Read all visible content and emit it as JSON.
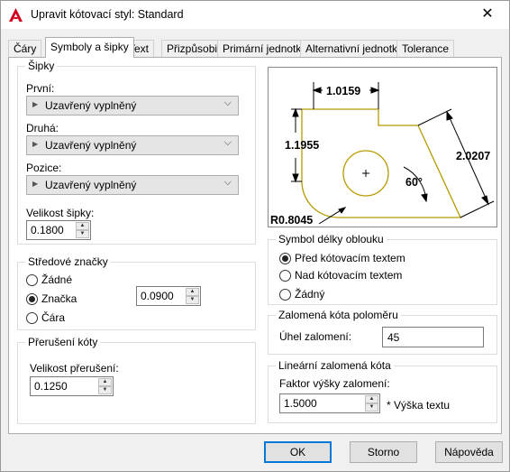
{
  "window": {
    "title": "Upravit kótovací styl: Standard",
    "close_glyph": "✕"
  },
  "tabs": [
    {
      "label": "Čáry"
    },
    {
      "label": "Symboly a šipky"
    },
    {
      "label": "Text"
    },
    {
      "label": "Přizpůsobit"
    },
    {
      "label": "Primární jednotky"
    },
    {
      "label": "Alternativní jednotky"
    },
    {
      "label": "Tolerance"
    }
  ],
  "arrows": {
    "title": "Šipky",
    "first_label": "První:",
    "first_value": "Uzavřený vyplněný",
    "second_label": "Druhá:",
    "second_value": "Uzavřený vyplněný",
    "leader_label": "Pozice:",
    "leader_value": "Uzavřený vyplněný",
    "size_label": "Velikost šipky:",
    "size_value": "0.1800"
  },
  "center_marks": {
    "title": "Středové značky",
    "none": "Žádné",
    "mark": "Značka",
    "line": "Čára",
    "selected": "mark",
    "size_value": "0.0900"
  },
  "dimension_break": {
    "title": "Přerušení kóty",
    "size_label": "Velikost přerušení:",
    "size_value": "0.1250"
  },
  "preview": {
    "dim_top": "1.0159",
    "dim_left": "1.1955",
    "dim_diag": "2.0207",
    "angle": "60°",
    "radius": "R0.8045",
    "line_color": "#b59a00"
  },
  "arc_symbol": {
    "title": "Symbol délky oblouku",
    "preceding": "Před kótovacím textem",
    "above": "Nad kótovacím textem",
    "none": "Žádný",
    "selected": "preceding"
  },
  "radius_jog": {
    "title": "Zalomená kóta poloměru",
    "angle_label": "Úhel zalomení:",
    "angle_value": "45"
  },
  "linear_jog": {
    "title": "Lineární zalomená kóta",
    "factor_label": "Faktor výšky zalomení:",
    "factor_value": "1.5000",
    "suffix": "* Výška textu"
  },
  "buttons": {
    "ok": "OK",
    "cancel": "Storno",
    "help": "Nápověda"
  }
}
